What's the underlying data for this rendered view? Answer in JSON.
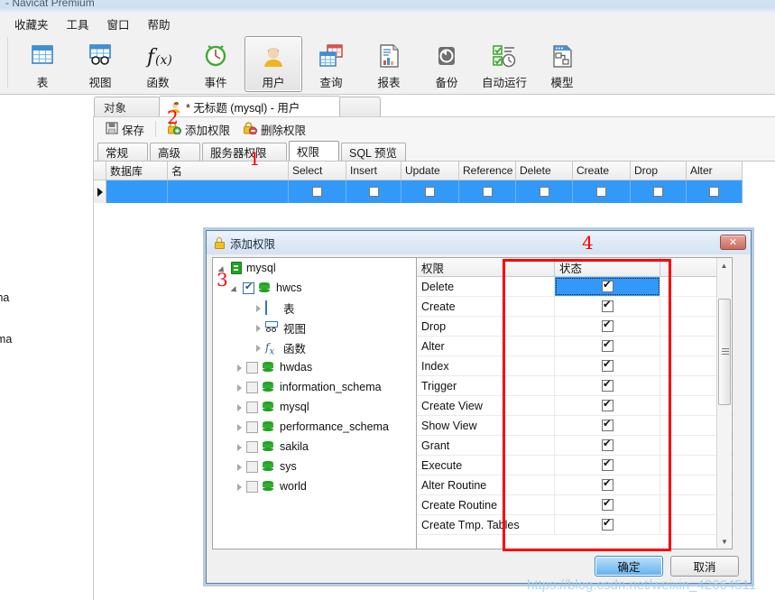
{
  "window": {
    "title": "- Navicat Premium"
  },
  "menubar": {
    "items": [
      {
        "label": "收藏夹",
        "name": "menu-favorites"
      },
      {
        "label": "工具",
        "name": "menu-tools"
      },
      {
        "label": "窗口",
        "name": "menu-window"
      },
      {
        "label": "帮助",
        "name": "menu-help"
      }
    ]
  },
  "toolbar": {
    "items": [
      {
        "label": "表",
        "icon": "table-icon",
        "active": false
      },
      {
        "label": "视图",
        "icon": "view-icon",
        "active": false
      },
      {
        "label": "函数",
        "icon": "function-icon",
        "active": false
      },
      {
        "label": "事件",
        "icon": "event-icon",
        "active": false
      },
      {
        "label": "用户",
        "icon": "user-icon",
        "active": true
      },
      {
        "label": "查询",
        "icon": "query-icon",
        "active": false
      },
      {
        "label": "报表",
        "icon": "report-icon",
        "active": false
      },
      {
        "label": "备份",
        "icon": "backup-icon",
        "active": false
      },
      {
        "label": "自动运行",
        "icon": "automation-icon",
        "active": false
      },
      {
        "label": "模型",
        "icon": "model-icon",
        "active": false
      }
    ]
  },
  "doc_tabs": [
    {
      "label": "对象",
      "selected": false
    },
    {
      "label": "* 无标题 (mysql) - 用户",
      "selected": true
    }
  ],
  "sub_toolbar": {
    "save": "保存",
    "add_privilege": "添加权限",
    "delete_privilege": "删除权限"
  },
  "inner_tabs": [
    {
      "label": "常规",
      "selected": false
    },
    {
      "label": "高级",
      "selected": false
    },
    {
      "label": "服务器权限",
      "selected": false
    },
    {
      "label": "权限",
      "selected": true
    },
    {
      "label": "SQL 预览",
      "selected": false
    }
  ],
  "grid": {
    "columns": [
      "数据库",
      "名",
      "Select",
      "Insert",
      "Update",
      "Reference",
      "Delete",
      "Create",
      "Drop",
      "Alter"
    ],
    "rows": [
      {
        "数据库": "",
        "名": "",
        "Select": false,
        "Insert": false,
        "Update": false,
        "Reference": false,
        "Delete": false,
        "Create": false,
        "Drop": false,
        "Alter": false,
        "selected": true
      }
    ]
  },
  "left_pane_fragments": [
    "ema",
    "hema"
  ],
  "dialog": {
    "title": "添加权限",
    "close_label": "✕",
    "tree": [
      {
        "label": "mysql",
        "depth": 0,
        "expander": "open",
        "checkbox": "none",
        "icon": "server-icon"
      },
      {
        "label": "hwcs",
        "depth": 1,
        "expander": "open",
        "checkbox": "checked",
        "icon": "database-icon"
      },
      {
        "label": "表",
        "depth": 2,
        "expander": "closed",
        "checkbox": "none",
        "icon": "table-icon"
      },
      {
        "label": "视图",
        "depth": 2,
        "expander": "closed",
        "checkbox": "none",
        "icon": "view-icon"
      },
      {
        "label": "函数",
        "depth": 2,
        "expander": "closed",
        "checkbox": "none",
        "icon": "function-icon"
      },
      {
        "label": "hwdas",
        "depth": 1,
        "expander": "closed",
        "checkbox": "unchecked",
        "icon": "database-icon"
      },
      {
        "label": "information_schema",
        "depth": 1,
        "expander": "closed",
        "checkbox": "unchecked",
        "icon": "database-icon"
      },
      {
        "label": "mysql",
        "depth": 1,
        "expander": "closed",
        "checkbox": "unchecked",
        "icon": "database-icon"
      },
      {
        "label": "performance_schema",
        "depth": 1,
        "expander": "closed",
        "checkbox": "unchecked",
        "icon": "database-icon"
      },
      {
        "label": "sakila",
        "depth": 1,
        "expander": "closed",
        "checkbox": "unchecked",
        "icon": "database-icon"
      },
      {
        "label": "sys",
        "depth": 1,
        "expander": "closed",
        "checkbox": "unchecked",
        "icon": "database-icon"
      },
      {
        "label": "world",
        "depth": 1,
        "expander": "closed",
        "checkbox": "unchecked",
        "icon": "database-icon"
      }
    ],
    "perm_headers": {
      "name": "权限",
      "state": "状态"
    },
    "permissions": [
      {
        "name": "Delete",
        "checked": true,
        "selected": true
      },
      {
        "name": "Create",
        "checked": true,
        "selected": false
      },
      {
        "name": "Drop",
        "checked": true,
        "selected": false
      },
      {
        "name": "Alter",
        "checked": true,
        "selected": false
      },
      {
        "name": "Index",
        "checked": true,
        "selected": false
      },
      {
        "name": "Trigger",
        "checked": true,
        "selected": false
      },
      {
        "name": "Create View",
        "checked": true,
        "selected": false
      },
      {
        "name": "Show View",
        "checked": true,
        "selected": false
      },
      {
        "name": "Grant",
        "checked": true,
        "selected": false
      },
      {
        "name": "Execute",
        "checked": true,
        "selected": false
      },
      {
        "name": "Alter Routine",
        "checked": true,
        "selected": false
      },
      {
        "name": "Create Routine",
        "checked": true,
        "selected": false
      },
      {
        "name": "Create Tmp. Tables",
        "checked": true,
        "selected": false
      }
    ],
    "ok_label": "确定",
    "cancel_label": "取消"
  },
  "annotations": [
    {
      "label": "1",
      "name": "annotation-1"
    },
    {
      "label": "2",
      "name": "annotation-2"
    },
    {
      "label": "3",
      "name": "annotation-3"
    },
    {
      "label": "4",
      "name": "annotation-4"
    }
  ],
  "watermark": "https://blog.csdn.net/weixin_42664511",
  "colors": {
    "selection_blue": "#3399f9",
    "annotation_red": "#ff0000",
    "chrome_gray": "#f1f1f1",
    "dialog_border": "#5a7fa8"
  }
}
